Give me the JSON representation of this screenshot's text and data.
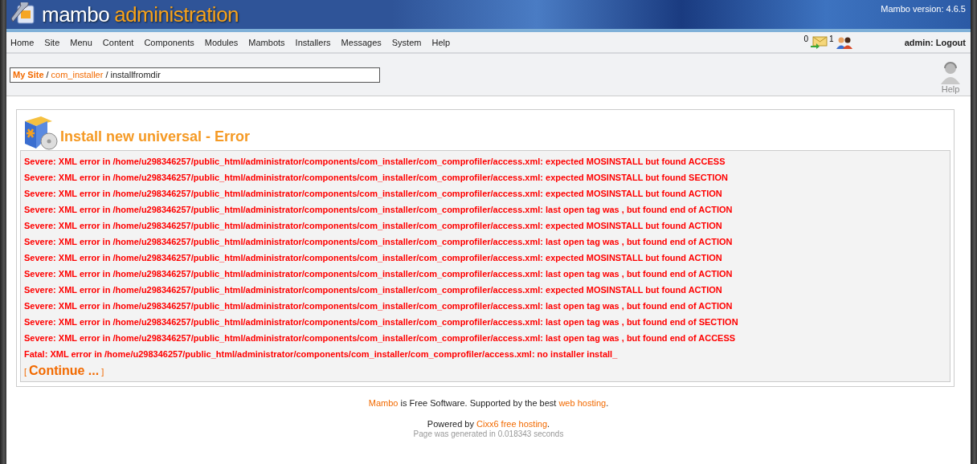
{
  "header": {
    "title_part1": "mambo",
    "title_part2": "administration",
    "version": "Mambo version: 4.6.5"
  },
  "menu": [
    "Home",
    "Site",
    "Menu",
    "Content",
    "Components",
    "Modules",
    "Mambots",
    "Installers",
    "Messages",
    "System",
    "Help"
  ],
  "status": {
    "messages_count": "0",
    "users_count": "1",
    "user": "admin: Logout"
  },
  "breadcrumb": [
    {
      "text": "My Site",
      "kind": "home"
    },
    {
      "text": "/",
      "kind": "separator"
    },
    {
      "text": "com_installer",
      "kind": "link"
    },
    {
      "text": "/",
      "kind": "separator"
    },
    {
      "text": "installfromdir",
      "kind": "current"
    }
  ],
  "help_label": "Help",
  "page": {
    "title": "Install new universal - Error",
    "errors": [
      "Severe: XML error in /home/u298346257/public_html/administrator/components/com_installer/com_comprofiler/access.xml: expected MOSINSTALL but found ACCESS",
      "Severe: XML error in /home/u298346257/public_html/administrator/components/com_installer/com_comprofiler/access.xml: expected MOSINSTALL but found SECTION",
      "Severe: XML error in /home/u298346257/public_html/administrator/components/com_installer/com_comprofiler/access.xml: expected MOSINSTALL but found ACTION",
      "Severe: XML error in /home/u298346257/public_html/administrator/components/com_installer/com_comprofiler/access.xml: last open tag was , but found end of ACTION",
      "Severe: XML error in /home/u298346257/public_html/administrator/components/com_installer/com_comprofiler/access.xml: expected MOSINSTALL but found ACTION",
      "Severe: XML error in /home/u298346257/public_html/administrator/components/com_installer/com_comprofiler/access.xml: last open tag was , but found end of ACTION",
      "Severe: XML error in /home/u298346257/public_html/administrator/components/com_installer/com_comprofiler/access.xml: expected MOSINSTALL but found ACTION",
      "Severe: XML error in /home/u298346257/public_html/administrator/components/com_installer/com_comprofiler/access.xml: last open tag was , but found end of ACTION",
      "Severe: XML error in /home/u298346257/public_html/administrator/components/com_installer/com_comprofiler/access.xml: expected MOSINSTALL but found ACTION",
      "Severe: XML error in /home/u298346257/public_html/administrator/components/com_installer/com_comprofiler/access.xml: last open tag was , but found end of ACTION",
      "Severe: XML error in /home/u298346257/public_html/administrator/components/com_installer/com_comprofiler/access.xml: last open tag was , but found end of SECTION",
      "Severe: XML error in /home/u298346257/public_html/administrator/components/com_installer/com_comprofiler/access.xml: last open tag was , but found end of ACCESS",
      "Fatal: XML error in /home/u298346257/public_html/administrator/components/com_installer/com_comprofiler/access.xml: no installer install_"
    ],
    "continue": {
      "open": "[",
      "label": "Continue ...",
      "close": "]"
    }
  },
  "footer": {
    "line1": {
      "link": "Mambo",
      "text": " is Free Software. Supported by the best ",
      "link2": "web hosting",
      "end": "."
    },
    "line2": {
      "text": "Powered by ",
      "link": "Cixx6 free hosting",
      "end": "."
    },
    "generated": "Page was generated in 0.018343 seconds"
  }
}
